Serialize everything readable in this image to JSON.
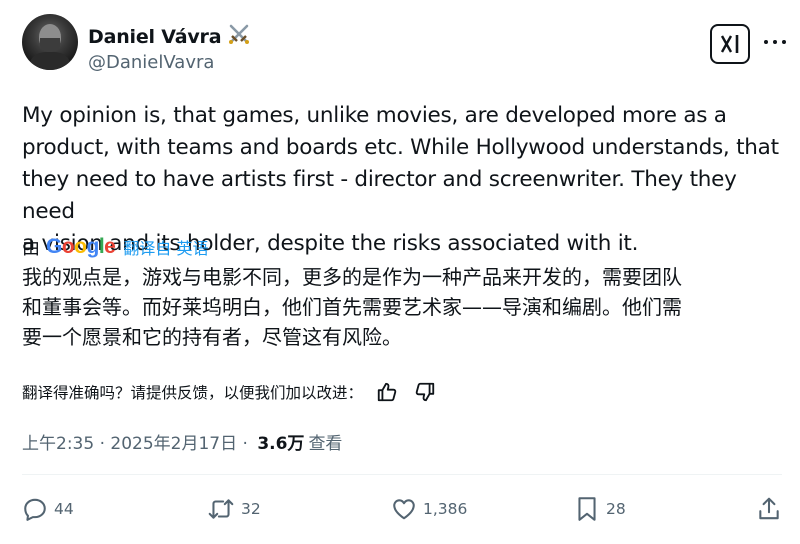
{
  "author": {
    "name": "Daniel Vávra",
    "handle": "@DanielVavra"
  },
  "tweet": {
    "text": "My opinion is, that games, unlike movies, are developed more as a\nproduct, with teams and boards etc. While Hollywood understands, that\nthey need to have artists first - director and screenwriter. They they need\na vision and its holder, despite the risks associated with it."
  },
  "translation": {
    "by_label": "由",
    "provider": "Google",
    "from_label": "翻译自 英语",
    "text": "我的观点是，游戏与电影不同，更多的是作为一种产品来开发的，需要团队\n和董事会等。而好莱坞明白，他们首先需要艺术家——导演和编剧。他们需\n要一个愿景和它的持有者，尽管这有风险。",
    "feedback_question": "翻译得准确吗？请提供反馈，以便我们加以改进："
  },
  "meta": {
    "time": "上午2:35 · 2025年2月17日 · ",
    "views": "3.6万",
    "views_label": "查看"
  },
  "actions": {
    "replies": "44",
    "reposts": "32",
    "likes": "1,386",
    "bookmarks": "28"
  },
  "icons": {
    "badge": "crossed-swords-icon",
    "grok": "grok-icon",
    "more": "more-icon",
    "thumbs_up": "thumbs-up-icon",
    "thumbs_down": "thumbs-down-icon",
    "reply": "reply-icon",
    "repost": "repost-icon",
    "like": "heart-icon",
    "bookmark": "bookmark-icon",
    "share": "share-icon"
  },
  "colors": {
    "text": "#0f1419",
    "secondary": "#536471",
    "link": "#1d9bf0"
  }
}
